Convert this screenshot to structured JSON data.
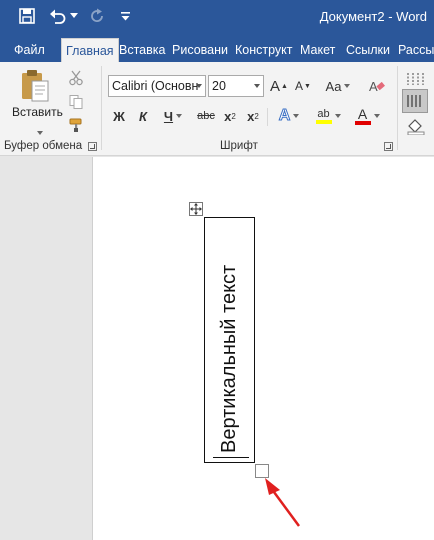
{
  "window": {
    "title": "Документ2 - Word"
  },
  "quick_access": {
    "icons": [
      "save-icon",
      "undo-icon",
      "undo-dropdown-icon",
      "redo-icon",
      "customize-qat-icon"
    ]
  },
  "tabs": [
    {
      "label": "Файл",
      "active": false
    },
    {
      "label": "Главная",
      "active": true
    },
    {
      "label": "Вставка",
      "active": false
    },
    {
      "label": "Рисовани",
      "active": false
    },
    {
      "label": "Конструкт",
      "active": false
    },
    {
      "label": "Макет",
      "active": false
    },
    {
      "label": "Ссылки",
      "active": false
    },
    {
      "label": "Рассы",
      "active": false
    }
  ],
  "ribbon": {
    "clipboard": {
      "paste_label": "Вставить",
      "group_label": "Буфер обмена"
    },
    "font": {
      "font_name": "Calibri (Основн",
      "font_size": "20",
      "bold": "Ж",
      "italic": "К",
      "underline": "Ч",
      "strikethrough": "abc",
      "subscript_base": "x",
      "subscript_mark": "2",
      "superscript_base": "x",
      "superscript_mark": "2",
      "grow": "A",
      "shrink": "A",
      "change_case": "Aa",
      "text_effects": "A",
      "highlight": "ab",
      "font_color": "A",
      "group_label": "Шрифт",
      "highlight_color": "#ffff00",
      "font_color_value": "#e00000"
    }
  },
  "document": {
    "cell_text": "Вертикальный текст"
  },
  "annotation": {
    "arrow_color": "#e0201f"
  },
  "colors": {
    "accent": "#2b579a"
  }
}
